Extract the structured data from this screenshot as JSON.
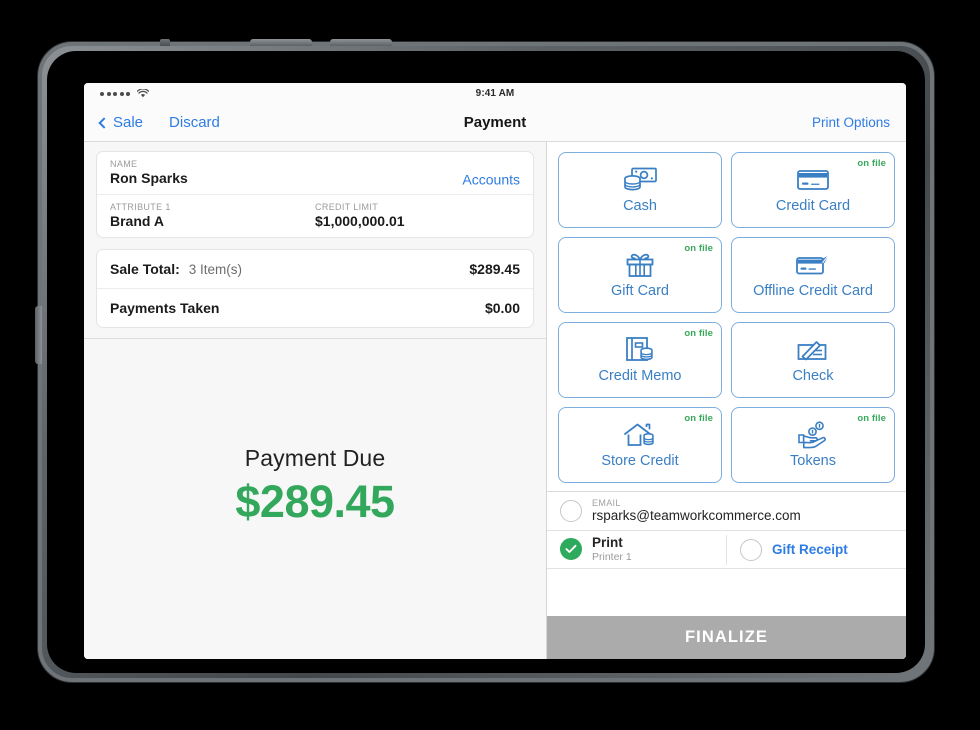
{
  "device": {
    "kind": "tablet"
  },
  "statusbar": {
    "signal_icon": "signal-dots-icon",
    "wifi_icon": "wifi-icon",
    "time": "9:41 AM"
  },
  "navbar": {
    "back_label": "Sale",
    "back_icon": "chevron-left-icon",
    "discard_label": "Discard",
    "title": "Payment",
    "print_options_label": "Print Options"
  },
  "customer_card": {
    "name_label": "NAME",
    "name_value": "Ron Sparks",
    "accounts_link": "Accounts",
    "attribute_label": "ATTRIBUTE 1",
    "attribute_value": "Brand A",
    "credit_limit_label": "CREDIT LIMIT",
    "credit_limit_value": "$1,000,000.01"
  },
  "totals_card": {
    "sale_total_label": "Sale Total:",
    "sale_total_items": "3 Item(s)",
    "sale_total_value": "$289.45",
    "payments_taken_label": "Payments Taken",
    "payments_taken_value": "$0.00"
  },
  "payment_due": {
    "label": "Payment Due",
    "amount": "$289.45",
    "color": "#33a85d"
  },
  "payment_methods": [
    {
      "label": "Cash",
      "icon": "cash-icon",
      "on_file": ""
    },
    {
      "label": "Credit Card",
      "icon": "credit-card-icon",
      "on_file": "on file"
    },
    {
      "label": "Gift Card",
      "icon": "gift-card-icon",
      "on_file": "on file"
    },
    {
      "label": "Offline Credit Card",
      "icon": "offline-credit-card-icon",
      "on_file": ""
    },
    {
      "label": "Credit Memo",
      "icon": "credit-memo-icon",
      "on_file": "on file"
    },
    {
      "label": "Check",
      "icon": "check-icon",
      "on_file": ""
    },
    {
      "label": "Store Credit",
      "icon": "store-credit-icon",
      "on_file": "on file"
    },
    {
      "label": "Tokens",
      "icon": "tokens-icon",
      "on_file": "on file"
    }
  ],
  "receipt_options": {
    "email_label": "EMAIL",
    "email_value": "rsparks@teamworkcommerce.com",
    "email_selected": false,
    "print_label": "Print",
    "print_sub": "Printer 1",
    "print_selected": true,
    "gift_receipt_label": "Gift Receipt",
    "gift_receipt_selected": false
  },
  "finalize": {
    "label": "FINALIZE"
  },
  "colors": {
    "accent_blue": "#2e7ce4",
    "tile_blue": "#3a7fc4",
    "tile_border": "#7dadde",
    "green": "#33a85d",
    "disabled_gray": "#ababab"
  }
}
